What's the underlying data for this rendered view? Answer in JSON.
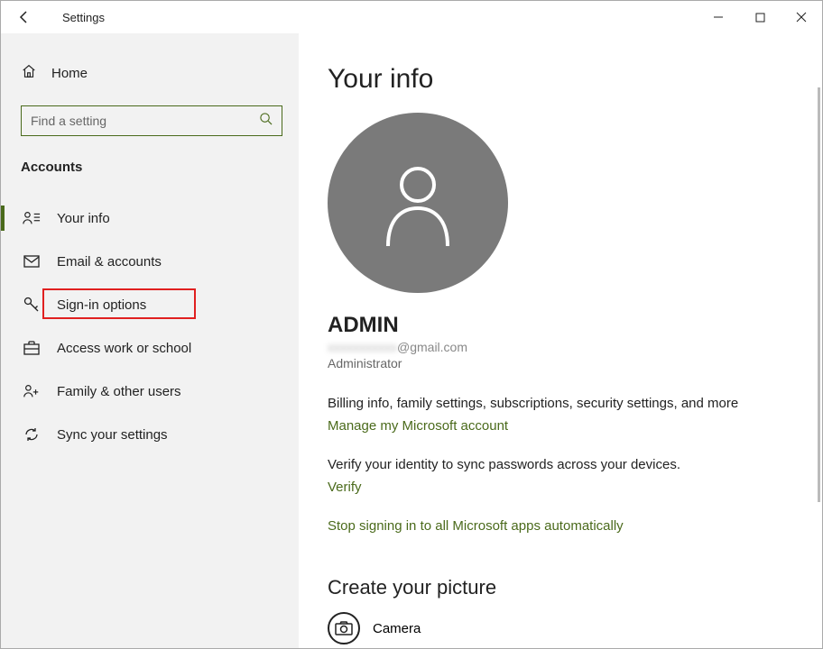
{
  "titlebar": {
    "title": "Settings"
  },
  "sidebar": {
    "home_label": "Home",
    "search_placeholder": "Find a setting",
    "section_title": "Accounts",
    "items": [
      {
        "label": "Your info"
      },
      {
        "label": "Email & accounts"
      },
      {
        "label": "Sign-in options"
      },
      {
        "label": "Access work or school"
      },
      {
        "label": "Family & other users"
      },
      {
        "label": "Sync your settings"
      }
    ],
    "highlighted_index": 2
  },
  "main": {
    "heading": "Your info",
    "username": "ADMIN",
    "email_suffix": "@gmail.com",
    "role": "Administrator",
    "billing_desc": "Billing info, family settings, subscriptions, security settings, and more",
    "manage_link": "Manage my Microsoft account",
    "verify_desc": "Verify your identity to sync passwords across your devices.",
    "verify_link": "Verify",
    "stop_link": "Stop signing in to all Microsoft apps automatically",
    "picture_heading": "Create your picture",
    "camera_label": "Camera"
  }
}
